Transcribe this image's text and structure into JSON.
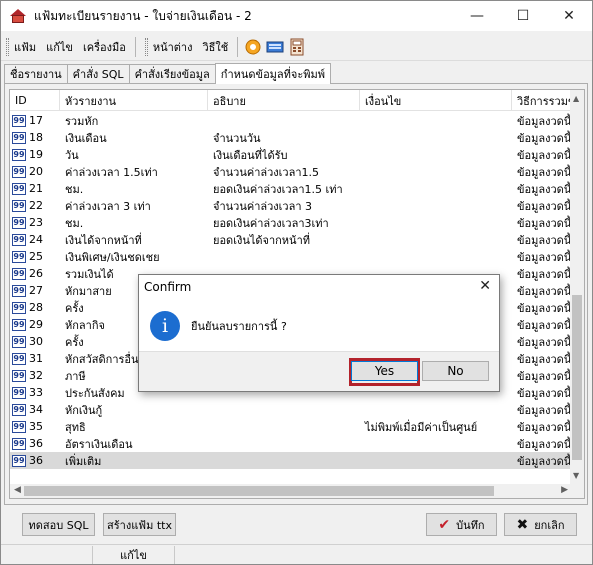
{
  "window": {
    "title": "แฟ้มทะเบียนรายงาน - ใบจ่ายเงินเดือน - 2",
    "minimize_glyph": "—",
    "maximize_glyph": "☐",
    "close_glyph": "✕"
  },
  "menu": {
    "items": [
      "แฟ้ม",
      "แก้ไข",
      "เครื่องมือ",
      "หน้าต่าง",
      "วิธีใช้"
    ]
  },
  "tabs": [
    {
      "label": "ชื่อรายงาน",
      "active": false
    },
    {
      "label": "คำสั่ง SQL",
      "active": false
    },
    {
      "label": "คำสั่งเรียงข้อมูล",
      "active": false
    },
    {
      "label": "กำหนดข้อมูลที่จะพิมพ์",
      "active": true
    }
  ],
  "grid": {
    "columns": [
      "ID",
      "หัวรายงาน",
      "อธิบาย",
      "เงื่อนไข",
      "วิธีการรวมข้อ"
    ],
    "id_icon_text": "99",
    "rows": [
      {
        "id": "17",
        "title": "รวมหัก",
        "desc": "",
        "cond": "",
        "method": "ข้อมูลงวดนี้"
      },
      {
        "id": "18",
        "title": "เงินเดือน",
        "desc": "จำนวนวัน",
        "cond": "",
        "method": "ข้อมูลงวดนี้"
      },
      {
        "id": "19",
        "title": "วัน",
        "desc": "เงินเดือนที่ได้รับ",
        "cond": "",
        "method": "ข้อมูลงวดนี้"
      },
      {
        "id": "20",
        "title": "ค่าล่วงเวลา 1.5เท่า",
        "desc": "จำนวนค่าล่วงเวลา1.5",
        "cond": "",
        "method": "ข้อมูลงวดนี้"
      },
      {
        "id": "21",
        "title": "ชม.",
        "desc": "ยอดเงินค่าล่วงเวลา1.5 เท่า",
        "cond": "",
        "method": "ข้อมูลงวดนี้"
      },
      {
        "id": "22",
        "title": "ค่าล่วงเวลา 3 เท่า",
        "desc": "จำนวนค่าล่วงเวลา 3",
        "cond": "",
        "method": "ข้อมูลงวดนี้"
      },
      {
        "id": "23",
        "title": "ชม.",
        "desc": "ยอดเงินค่าล่วงเวลา3เท่า",
        "cond": "",
        "method": "ข้อมูลงวดนี้"
      },
      {
        "id": "24",
        "title": "เงินได้จากหน้าที่",
        "desc": "ยอดเงินได้จากหน้าที่",
        "cond": "",
        "method": "ข้อมูลงวดนี้"
      },
      {
        "id": "25",
        "title": "เงินพิเศษ/เงินชดเชย",
        "desc": "",
        "cond": "",
        "method": "ข้อมูลงวดนี้"
      },
      {
        "id": "26",
        "title": "รวมเงินได้",
        "desc": "",
        "cond": "",
        "method": "ข้อมูลงวดนี้"
      },
      {
        "id": "27",
        "title": "หักมาสาย",
        "desc": "",
        "cond": "",
        "method": "ข้อมูลงวดนี้"
      },
      {
        "id": "28",
        "title": "ครั้ง",
        "desc": "",
        "cond": "",
        "method": "ข้อมูลงวดนี้"
      },
      {
        "id": "29",
        "title": "หักลากิจ",
        "desc": "",
        "cond": "",
        "method": "ข้อมูลงวดนี้"
      },
      {
        "id": "30",
        "title": "ครั้ง",
        "desc": "",
        "cond": "",
        "method": "ข้อมูลงวดนี้"
      },
      {
        "id": "31",
        "title": "หักสวัสดิการอื่น",
        "desc": "",
        "cond": "",
        "method": "ข้อมูลงวดนี้"
      },
      {
        "id": "32",
        "title": "ภาษี",
        "desc": "",
        "cond": "",
        "method": "ข้อมูลงวดนี้"
      },
      {
        "id": "33",
        "title": "ประกันสังคม",
        "desc": "",
        "cond": "",
        "method": "ข้อมูลงวดนี้"
      },
      {
        "id": "34",
        "title": "หักเงินกู้",
        "desc": "",
        "cond": "",
        "method": "ข้อมูลงวดนี้"
      },
      {
        "id": "35",
        "title": "สุทธิ",
        "desc": "",
        "cond": "ไม่พิมพ์เมื่อมีค่าเป็นศูนย์",
        "method": "ข้อมูลงวดนี้"
      },
      {
        "id": "36",
        "title": "อัตราเงินเดือน",
        "desc": "",
        "cond": "",
        "method": "ข้อมูลงวดนี้"
      },
      {
        "id": "36",
        "title": "เพิ่มเติม",
        "desc": "",
        "cond": "",
        "method": "ข้อมูลงวดนี้"
      }
    ]
  },
  "buttons": {
    "test_sql": "ทดสอบ SQL",
    "create_ttx": "สร้างแฟ้ม ttx",
    "save": "บันทึก",
    "save_glyph": "✔",
    "cancel": "ยกเลิก",
    "cancel_glyph": "✖"
  },
  "status": {
    "mode": "แก้ไข"
  },
  "dialog": {
    "title": "Confirm",
    "message": "ยืนยันลบรายการนี้ ?",
    "icon_glyph": "i",
    "yes": "Yes",
    "no": "No"
  },
  "colors": {
    "highlight": "#b3232c",
    "info_icon": "#1c6dd0"
  }
}
